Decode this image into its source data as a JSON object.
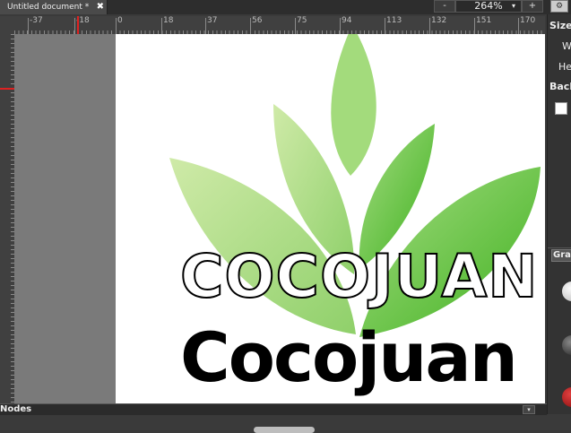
{
  "tab": {
    "title": "Untitled document *",
    "close": "✖"
  },
  "zoom": {
    "minus": "-",
    "value": "264%",
    "plus": "+",
    "caret": "▾"
  },
  "ruler": {
    "ticks": [
      "-37",
      "-18",
      "0",
      "18",
      "37",
      "56",
      "75",
      "94",
      "113",
      "132",
      "151",
      "170"
    ]
  },
  "canvas": {
    "outline_text": "COCOJUAN",
    "solid_text": "Cocojuan"
  },
  "panel": {
    "size_label": "Size",
    "width_label": "W",
    "height_label": "He",
    "background_label": "Back",
    "gradient_label": "Gra"
  },
  "bottom": {
    "label": "Nodes",
    "arrow": "▾"
  },
  "colors": {
    "leaf_light": "#c7e7a0",
    "leaf_mid": "#97d46d",
    "leaf_dark": "#4cb62a"
  }
}
